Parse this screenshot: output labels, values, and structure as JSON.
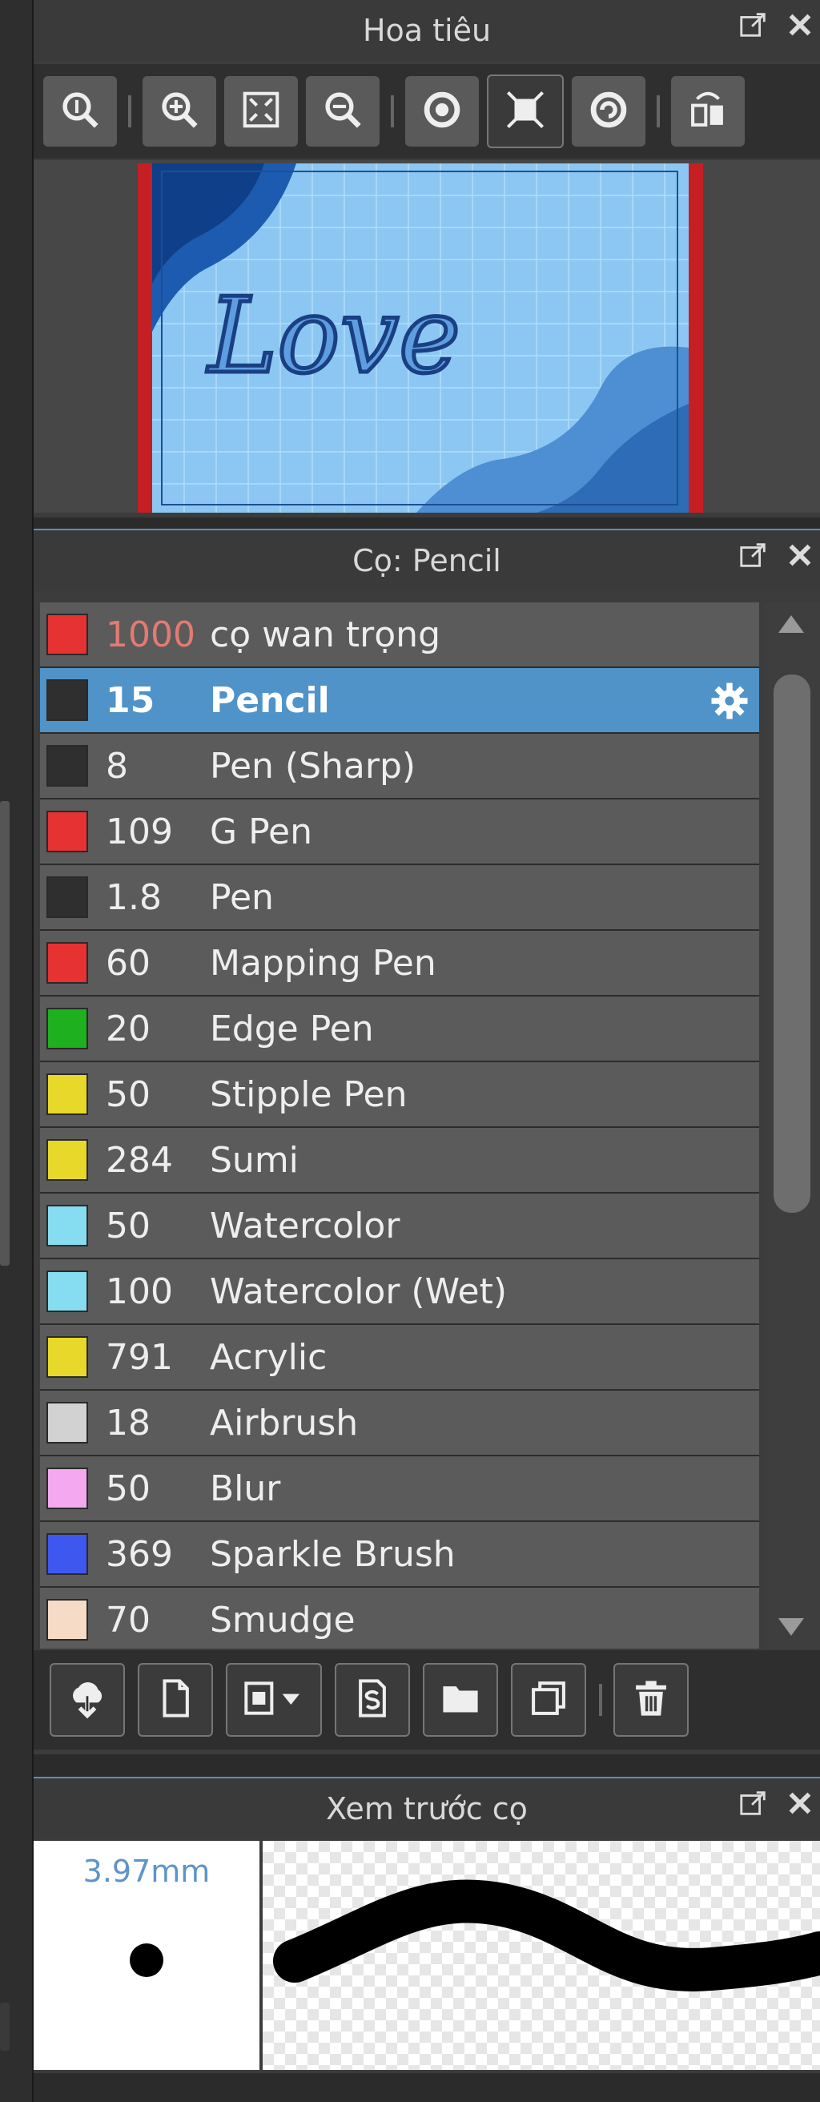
{
  "navigator": {
    "title": "Hoa tiêu"
  },
  "brush_panel": {
    "title": "Cọ: Pencil",
    "brushes": [
      {
        "size": "1000",
        "name": "cọ wan trọng",
        "color": "#e63232",
        "size_color": "#e37b72"
      },
      {
        "size": "15",
        "name": "Pencil",
        "color": "#2f2f2f",
        "selected": true
      },
      {
        "size": "8",
        "name": "Pen (Sharp)",
        "color": "#2f2f2f"
      },
      {
        "size": "109",
        "name": "G Pen",
        "color": "#e63232"
      },
      {
        "size": "1.8",
        "name": "Pen",
        "color": "#2f2f2f"
      },
      {
        "size": "60",
        "name": "Mapping Pen",
        "color": "#e63232"
      },
      {
        "size": "20",
        "name": "Edge Pen",
        "color": "#1fb01f"
      },
      {
        "size": "50",
        "name": "Stipple Pen",
        "color": "#e8d829"
      },
      {
        "size": "284",
        "name": "Sumi",
        "color": "#e8d829"
      },
      {
        "size": "50",
        "name": "Watercolor",
        "color": "#86ddf2"
      },
      {
        "size": "100",
        "name": "Watercolor (Wet)",
        "color": "#86ddf2"
      },
      {
        "size": "791",
        "name": "Acrylic",
        "color": "#e8d829"
      },
      {
        "size": "18",
        "name": "Airbrush",
        "color": "#d2d2d2"
      },
      {
        "size": "50",
        "name": "Blur",
        "color": "#f4a8f0"
      },
      {
        "size": "369",
        "name": "Sparkle Brush",
        "color": "#3e58ef"
      },
      {
        "size": "70",
        "name": "Smudge",
        "color": "#f6dcc6"
      }
    ]
  },
  "brush_preview": {
    "title": "Xem trước cọ",
    "size_label": "3.97mm"
  }
}
